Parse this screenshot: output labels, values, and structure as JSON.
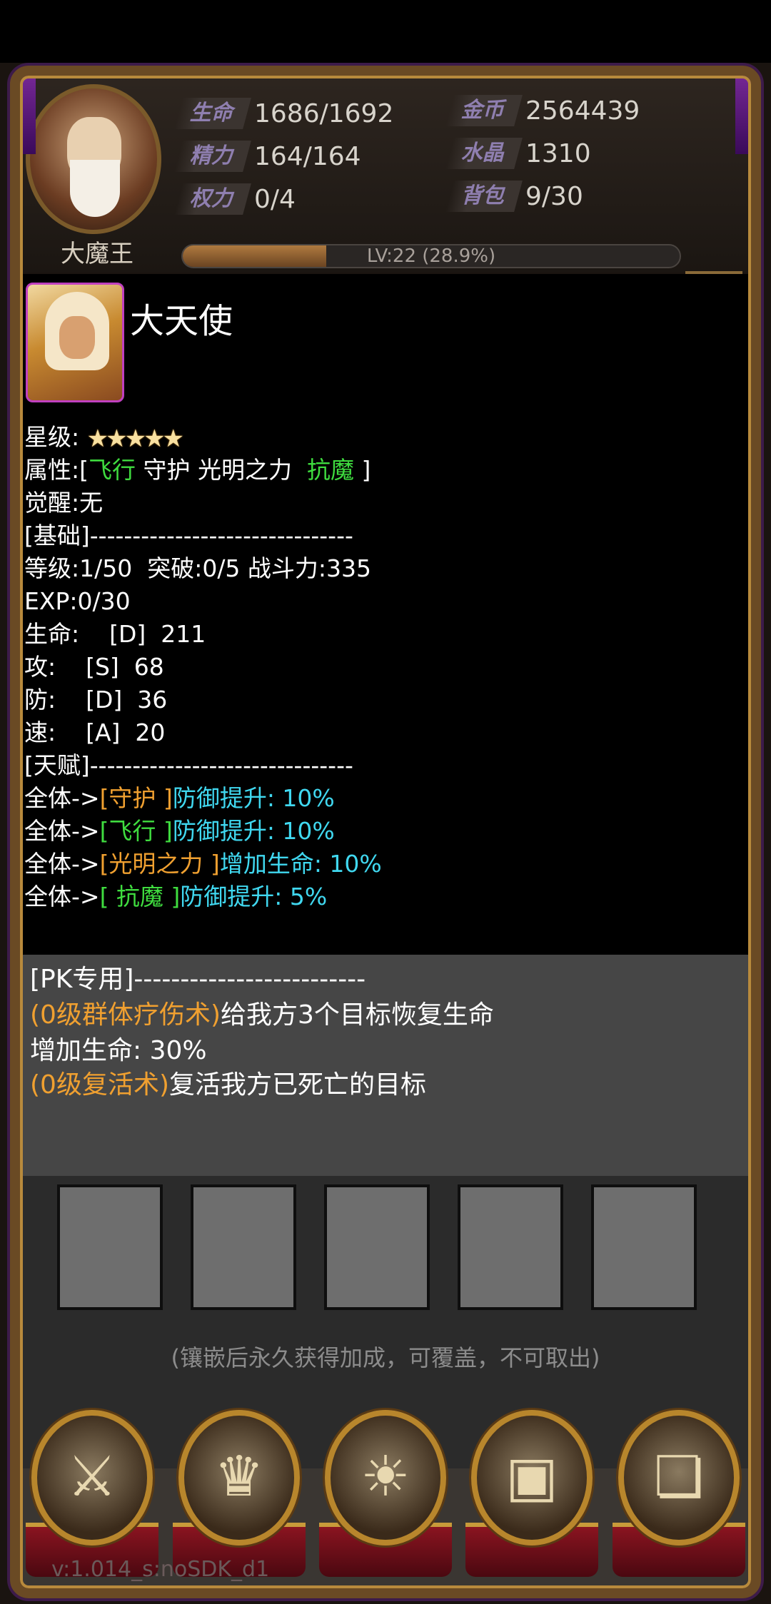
{
  "header": {
    "boss_name": "大魔王",
    "stats": [
      {
        "tag": "生命",
        "value": "1686/1692"
      },
      {
        "tag": "精力",
        "value": "164/164"
      },
      {
        "tag": "权力",
        "value": "0/4"
      },
      {
        "tag": "金币",
        "value": "2564439"
      },
      {
        "tag": "水晶",
        "value": "1310"
      },
      {
        "tag": "背包",
        "value": "9/30"
      }
    ],
    "level_text": "LV:22 (28.9%)",
    "level_progress": 0.289
  },
  "hero": {
    "name": "大天使",
    "star_label": "星级:",
    "stars": "★★★★★",
    "attr_prefix": "属性:[",
    "attr_fly": "飞行",
    "attr_mid": " 守护 光明之力  ",
    "attr_anti": "抗魔",
    "attr_suffix": " ]",
    "awaken": "觉醒:无",
    "basic_header": "[基础]-------------------------------",
    "level_line": "等级:1/50  突破:0/5 战斗力:335",
    "exp_line": "EXP:0/30",
    "hp_line": "生命:    [D]  211",
    "atk_line": "攻:    [S]  68",
    "def_line": "防:    [D]  36",
    "spd_line": "速:    [A]  20",
    "talent_header": "[天赋]-------------------------------",
    "talents": [
      {
        "prefix": "全体->",
        "tag": "[守护 ]",
        "tag_color": "orange",
        "effect": "防御提升: 10%"
      },
      {
        "prefix": "全体->",
        "tag": "[飞行 ]",
        "tag_color": "mixed",
        "effect": "防御提升: 10%"
      },
      {
        "prefix": "全体->",
        "tag": "[光明之力 ]",
        "tag_color": "orange",
        "effect": "增加生命: 10%"
      },
      {
        "prefix": "全体->",
        "tag": "[ 抗魔 ]",
        "tag_color": "mixed",
        "effect": "防御提升: 5%"
      }
    ]
  },
  "pk": {
    "header": "[PK专用]-------------------------",
    "skill1_name": "(0级群体疗伤术)",
    "skill1_desc": "给我方3个目标恢复生命",
    "skill1_bonus": "增加生命: 30%",
    "skill2_name": "(0级复活术)",
    "skill2_desc": "复活我方已死亡的目标"
  },
  "slots_hint": "(镶嵌后永久获得加成，可覆盖，不可取出)",
  "nav": [
    {
      "icon": "shield-swords-icon"
    },
    {
      "icon": "golden-helmet-icon"
    },
    {
      "icon": "mystic-face-icon"
    },
    {
      "icon": "treasure-chest-icon"
    },
    {
      "icon": "open-book-icon"
    }
  ],
  "version": "v:1.014_s:noSDK_d1"
}
